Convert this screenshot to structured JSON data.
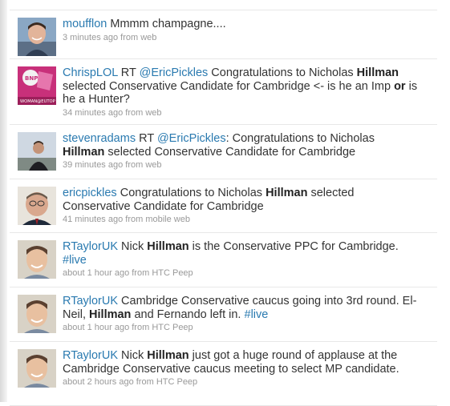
{
  "tweets": [
    {
      "user": "moufflon",
      "parts": [
        " Mmmm champagne...."
      ],
      "time": "3 minutes ago",
      "from_word": "from",
      "source": "web",
      "avatar": "avatar-man-smiling"
    },
    {
      "user": "ChrispLOL",
      "p0": " RT ",
      "p1": "@EricPickles",
      "p2": " Congratulations to Nicholas ",
      "p3": "Hillman",
      "p4": " selected Conservative Candidate for Cambridge <- is he an Imp ",
      "p5": "or",
      "p6": " is he a Hunter?",
      "time": "34 minutes ago",
      "from_word": "from",
      "source": "web",
      "avatar_caption": "WOMAN@EUTOP",
      "avatar_tag": "BNP"
    },
    {
      "user": "stevenradams",
      "p0": " RT ",
      "p1": "@EricPickles",
      "p2": ": Congratulations to Nicholas ",
      "p3": "Hillman",
      "p4": " selected Conservative Candidate for Cambridge",
      "time": "39 minutes ago",
      "from_word": "from",
      "source": "web"
    },
    {
      "user": "ericpickles",
      "p0": " Congratulations to Nicholas ",
      "p1": "Hillman",
      "p2": " selected Conservative Candidate for Cambridge",
      "time": "41 minutes ago",
      "from_word": "from",
      "source": "mobile web"
    },
    {
      "user": "RTaylorUK",
      "p0": " Nick ",
      "p1": "Hillman",
      "p2": " is the Conservative PPC for Cambridge. ",
      "p3": "#live",
      "time": "about 1 hour ago",
      "from_word": "from",
      "source": "HTC Peep"
    },
    {
      "user": "RTaylorUK",
      "p0": " Cambridge Conservative caucus going into 3rd round. El-Neil, ",
      "p1": "Hillman",
      "p2": " and Fernando left in. ",
      "p3": "#live",
      "time": "about 1 hour ago",
      "from_word": "from",
      "source": "HTC Peep"
    },
    {
      "user": "RTaylorUK",
      "p0": " Nick ",
      "p1": "Hillman",
      "p2": " just got a huge round of applause at the Cambridge Conservative caucus meeting to select MP candidate.",
      "time": "about 2 hours ago",
      "from_word": "from",
      "source": "HTC Peep"
    }
  ],
  "colors": {
    "link": "#2a7ab0",
    "meta": "#999999",
    "text": "#333333",
    "divider": "#e8e8e8"
  }
}
